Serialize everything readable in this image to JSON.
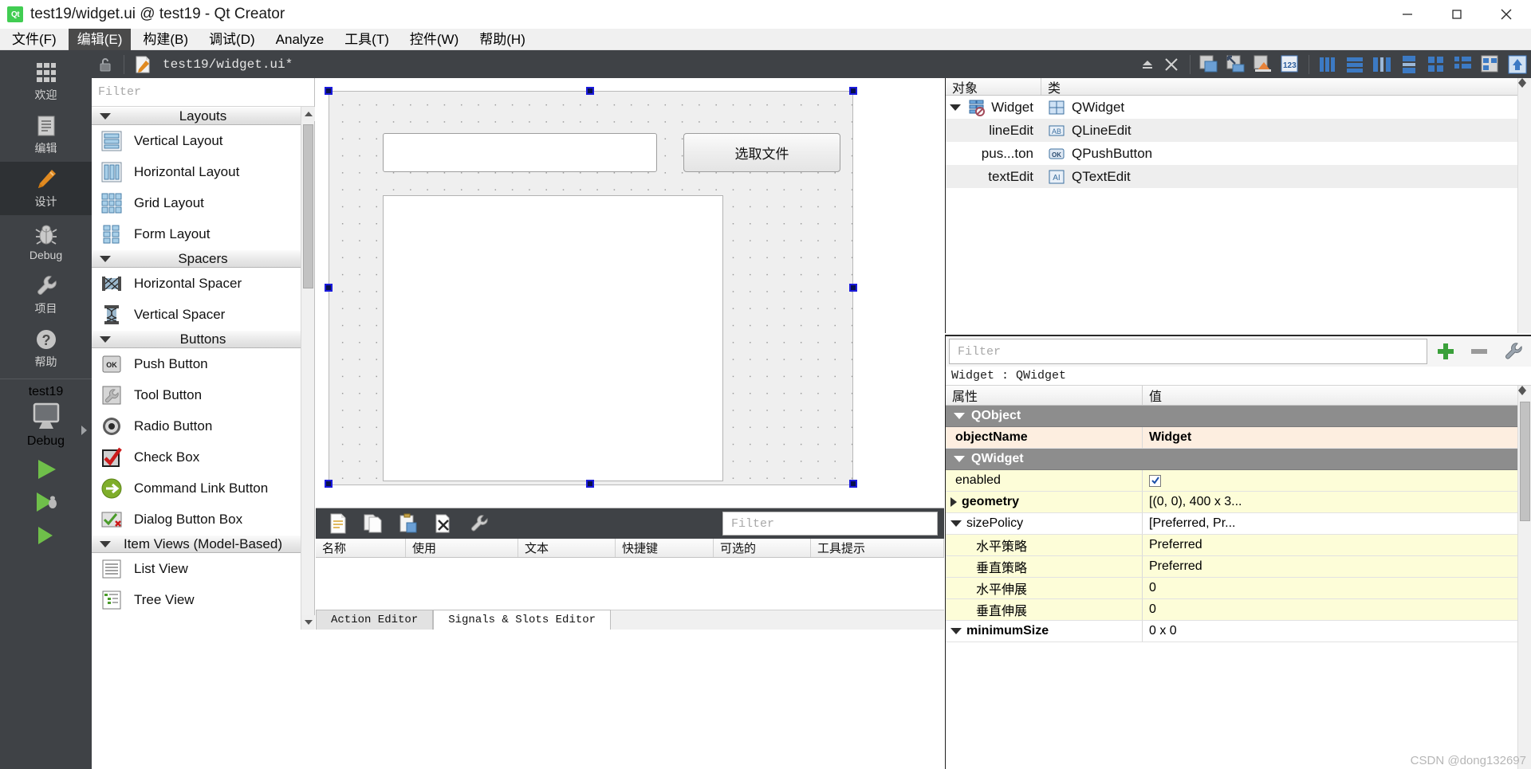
{
  "window": {
    "title": "test19/widget.ui @ test19 - Qt Creator",
    "logo_text": "Qt",
    "minimize_label": "minimize",
    "maximize_label": "maximize",
    "close_label": "close"
  },
  "menubar": {
    "items": [
      {
        "label": "文件(F)",
        "active": false
      },
      {
        "label": "编辑(E)",
        "active": true
      },
      {
        "label": "构建(B)",
        "active": false
      },
      {
        "label": "调试(D)",
        "active": false
      },
      {
        "label": "Analyze",
        "active": false
      },
      {
        "label": "工具(T)",
        "active": false
      },
      {
        "label": "控件(W)",
        "active": false
      },
      {
        "label": "帮助(H)",
        "active": false
      }
    ]
  },
  "modebar": {
    "modes": [
      {
        "label": "欢迎",
        "icon": "grid-icon",
        "selected": false
      },
      {
        "label": "编辑",
        "icon": "document-lines-icon",
        "selected": false
      },
      {
        "label": "设计",
        "icon": "pencil-icon",
        "selected": true
      },
      {
        "label": "Debug",
        "icon": "bug-icon",
        "selected": false
      },
      {
        "label": "项目",
        "icon": "wrench-icon",
        "selected": false
      },
      {
        "label": "帮助",
        "icon": "question-circle-icon",
        "selected": false
      }
    ],
    "kit": {
      "project": "test19",
      "build_config": "Debug",
      "icon": "monitor-icon"
    },
    "run_buttons": [
      {
        "name": "run-button",
        "icon": "play-icon"
      },
      {
        "name": "debug-button",
        "icon": "play-bug-icon"
      },
      {
        "name": "build-button",
        "icon": "hammer-icon"
      }
    ]
  },
  "designer_toolbar": {
    "lock_icon": "unlock-icon",
    "file_icon": "ui-file-icon",
    "filename": "test19/widget.ui*",
    "split_up_icon": "split-up-icon",
    "close_icon": "close-x-icon",
    "buttons": [
      {
        "name": "edit-widgets-button",
        "icon": "edit-widgets-icon"
      },
      {
        "name": "edit-signals-slots-button",
        "icon": "edit-signals-slots-icon"
      },
      {
        "name": "edit-buddies-button",
        "icon": "edit-buddies-icon"
      },
      {
        "name": "edit-tab-order-button",
        "icon": "edit-tab-order-icon"
      },
      {
        "name": "layout-horizontally-button",
        "icon": "layout-horizontal-icon"
      },
      {
        "name": "layout-vertically-button",
        "icon": "layout-vertical-icon"
      },
      {
        "name": "layout-splitter-horizontal-button",
        "icon": "splitter-horizontal-icon"
      },
      {
        "name": "layout-splitter-vertical-button",
        "icon": "splitter-vertical-icon"
      },
      {
        "name": "layout-grid-button",
        "icon": "layout-grid-icon"
      },
      {
        "name": "layout-form-button",
        "icon": "layout-form-icon"
      },
      {
        "name": "break-layout-button",
        "icon": "break-layout-icon"
      },
      {
        "name": "adjust-size-button",
        "icon": "adjust-size-icon"
      }
    ]
  },
  "widgetbox": {
    "filter_placeholder": "Filter",
    "groups": [
      {
        "title": "Layouts",
        "expanded": true,
        "items": [
          {
            "label": "Vertical Layout",
            "icon": "vertical-layout-icon"
          },
          {
            "label": "Horizontal Layout",
            "icon": "horizontal-layout-icon"
          },
          {
            "label": "Grid Layout",
            "icon": "grid-layout-icon"
          },
          {
            "label": "Form Layout",
            "icon": "form-layout-icon"
          }
        ]
      },
      {
        "title": "Spacers",
        "expanded": true,
        "items": [
          {
            "label": "Horizontal Spacer",
            "icon": "horizontal-spacer-icon"
          },
          {
            "label": "Vertical Spacer",
            "icon": "vertical-spacer-icon"
          }
        ]
      },
      {
        "title": "Buttons",
        "expanded": true,
        "items": [
          {
            "label": "Push Button",
            "icon": "push-button-icon"
          },
          {
            "label": "Tool Button",
            "icon": "tool-button-icon"
          },
          {
            "label": "Radio Button",
            "icon": "radio-button-icon"
          },
          {
            "label": "Check Box",
            "icon": "check-box-icon"
          },
          {
            "label": "Command Link Button",
            "icon": "command-link-icon"
          },
          {
            "label": "Dialog Button Box",
            "icon": "dialog-button-box-icon"
          }
        ]
      },
      {
        "title": "Item Views (Model-Based)",
        "expanded": true,
        "items": [
          {
            "label": "List View",
            "icon": "list-view-icon"
          },
          {
            "label": "Tree View",
            "icon": "tree-view-icon"
          }
        ]
      }
    ]
  },
  "form": {
    "lineedit_text": "",
    "pushbutton_text": "选取文件",
    "textedit_text": ""
  },
  "action_editor": {
    "toolbar_buttons": [
      {
        "name": "new-action-button",
        "icon": "new-document-icon"
      },
      {
        "name": "copy-action-button",
        "icon": "copy-icon"
      },
      {
        "name": "paste-action-button",
        "icon": "paste-icon"
      },
      {
        "name": "delete-action-button",
        "icon": "delete-x-icon"
      },
      {
        "name": "edit-action-button",
        "icon": "wrench-tool-icon"
      }
    ],
    "filter_placeholder": "Filter",
    "columns": [
      "名称",
      "使用",
      "文本",
      "快捷键",
      "可选的",
      "工具提示"
    ],
    "rows": [],
    "tabs": [
      {
        "label": "Action Editor",
        "selected": false
      },
      {
        "label": "Signals & Slots Editor",
        "selected": true
      }
    ]
  },
  "object_inspector": {
    "columns": [
      "对象",
      "类"
    ],
    "rows": [
      {
        "name": "Widget",
        "class": "QWidget",
        "indent": 0,
        "expander": true,
        "icon": "widget-icon",
        "class_icon": "qwidget-icon",
        "alt": false
      },
      {
        "name": "lineEdit",
        "class": "QLineEdit",
        "indent": 1,
        "expander": false,
        "icon": "",
        "class_icon": "qlineedit-icon",
        "alt": true
      },
      {
        "name": "pus...ton",
        "class": "QPushButton",
        "indent": 1,
        "expander": false,
        "icon": "",
        "class_icon": "qpushbutton-icon",
        "alt": false
      },
      {
        "name": "textEdit",
        "class": "QTextEdit",
        "indent": 1,
        "expander": false,
        "icon": "",
        "class_icon": "qtextedit-icon",
        "alt": true
      }
    ]
  },
  "property_editor": {
    "filter_placeholder": "Filter",
    "add_button_icon": "plus-icon",
    "remove_button_icon": "minus-icon",
    "config_button_icon": "configure-icon",
    "object_line": "Widget : QWidget",
    "columns": [
      "属性",
      "值"
    ],
    "rows": [
      {
        "type": "group",
        "key": "QObject",
        "value": "",
        "expanded": true
      },
      {
        "type": "peach",
        "key": "objectName",
        "value": "Widget",
        "bold": true
      },
      {
        "type": "group",
        "key": "QWidget",
        "value": "",
        "expanded": true
      },
      {
        "type": "yellow",
        "key": "enabled",
        "value": "",
        "checkbox": true,
        "checked": true
      },
      {
        "type": "yellow",
        "key": "geometry",
        "value": "[(0, 0), 400 x 3...",
        "bold": true,
        "expander": "right"
      },
      {
        "type": "plain",
        "key": "sizePolicy",
        "value": "[Preferred, Pr...",
        "expanded": true,
        "expander": "down"
      },
      {
        "type": "yellow2",
        "key": "水平策略",
        "value": "Preferred",
        "indent": 2
      },
      {
        "type": "yellow2",
        "key": "垂直策略",
        "value": "Preferred",
        "indent": 2
      },
      {
        "type": "yellow2",
        "key": "水平伸展",
        "value": "0",
        "indent": 2
      },
      {
        "type": "yellow2",
        "key": "垂直伸展",
        "value": "0",
        "indent": 2
      },
      {
        "type": "plain",
        "key": "minimumSize",
        "value": "0 x 0",
        "expander": "down"
      }
    ]
  },
  "watermark": "CSDN @dong132697"
}
